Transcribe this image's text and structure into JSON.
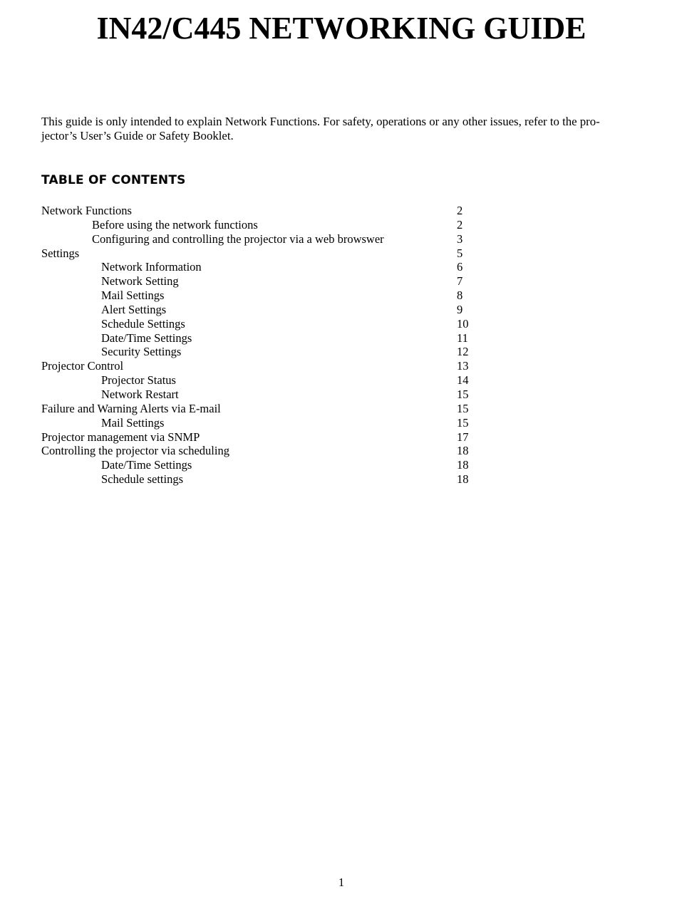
{
  "document": {
    "title": "IN42/C445 NETWORKING GUIDE",
    "intro": "This guide is only intended to explain Network Functions. For safety, operations or any other issues, refer to the pro-­jector’s User’s Guide or Safety Booklet.",
    "toc_heading": "TABLE OF CONTENTS",
    "toc": [
      {
        "label": "Network Functions",
        "page": "2",
        "level": 1
      },
      {
        "label": "Before using the network functions",
        "page": "2",
        "level": 2
      },
      {
        "label": "Configuring and controlling the projector via a web browswer",
        "page": "3",
        "level": 2
      },
      {
        "label": "Settings",
        "page": "5",
        "level": 1
      },
      {
        "label": "Network Information",
        "page": "6",
        "level": 3
      },
      {
        "label": "Network Setting",
        "page": "7",
        "level": 3
      },
      {
        "label": "Mail Settings",
        "page": "8",
        "level": 3
      },
      {
        "label": "Alert Settings",
        "page": "9",
        "level": 3
      },
      {
        "label": "Schedule Settings",
        "page": "10",
        "level": 3
      },
      {
        "label": "Date/Time Settings",
        "page": "11",
        "level": 3
      },
      {
        "label": "Security Settings",
        "page": "12",
        "level": 3
      },
      {
        "label": "Projector Control",
        "page": "13",
        "level": 1
      },
      {
        "label": "Projector Status",
        "page": "14",
        "level": 3
      },
      {
        "label": "Network Restart",
        "page": "15",
        "level": 3
      },
      {
        "label": "Failure and Warning Alerts via E-mail",
        "page": "15",
        "level": 1
      },
      {
        "label": "Mail Settings",
        "page": "15",
        "level": 3
      },
      {
        "label": "Projector management via SNMP",
        "page": "17",
        "level": 1
      },
      {
        "label": "Controlling the projector via scheduling",
        "page": "18",
        "level": 1
      },
      {
        "label": "Date/Time Settings",
        "page": "18",
        "level": 3
      },
      {
        "label": "Schedule settings",
        "page": "18",
        "level": 3
      }
    ],
    "page_number": "1"
  }
}
